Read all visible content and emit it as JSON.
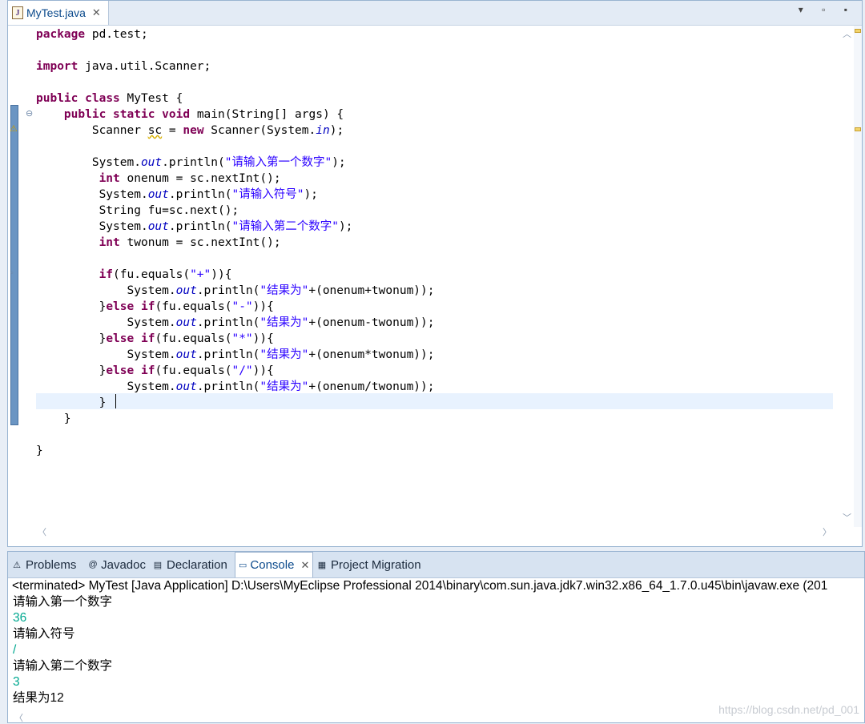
{
  "editor": {
    "tab_title": "MyTest.java",
    "tab_icon": "java-file-icon",
    "window_controls": "▾ ▫ ▪",
    "lines": [
      [
        {
          "t": "package",
          "c": "kw"
        },
        {
          "t": " pd.test;"
        }
      ],
      [],
      [
        {
          "t": "import",
          "c": "kw"
        },
        {
          "t": " java.util.Scanner;"
        }
      ],
      [],
      [
        {
          "t": "public",
          "c": "kw"
        },
        {
          "t": " "
        },
        {
          "t": "class",
          "c": "kw"
        },
        {
          "t": " MyTest {"
        }
      ],
      [
        {
          "t": "    "
        },
        {
          "t": "public",
          "c": "kw"
        },
        {
          "t": " "
        },
        {
          "t": "static",
          "c": "kw"
        },
        {
          "t": " "
        },
        {
          "t": "void",
          "c": "kw"
        },
        {
          "t": " main(String[] args) {"
        }
      ],
      [
        {
          "t": "        Scanner "
        },
        {
          "t": "sc",
          "c": "warn"
        },
        {
          "t": " = "
        },
        {
          "t": "new",
          "c": "kw"
        },
        {
          "t": " Scanner(System."
        },
        {
          "t": "in",
          "c": "fld"
        },
        {
          "t": ");"
        }
      ],
      [],
      [
        {
          "t": "        System."
        },
        {
          "t": "out",
          "c": "fld"
        },
        {
          "t": ".println("
        },
        {
          "t": "\"请输入第一个数字\"",
          "c": "str"
        },
        {
          "t": ");"
        }
      ],
      [
        {
          "t": "         "
        },
        {
          "t": "int",
          "c": "kw"
        },
        {
          "t": " onenum = sc.nextInt();"
        }
      ],
      [
        {
          "t": "         System."
        },
        {
          "t": "out",
          "c": "fld"
        },
        {
          "t": ".println("
        },
        {
          "t": "\"请输入符号\"",
          "c": "str"
        },
        {
          "t": ");"
        }
      ],
      [
        {
          "t": "         String fu=sc.next();"
        }
      ],
      [
        {
          "t": "         System."
        },
        {
          "t": "out",
          "c": "fld"
        },
        {
          "t": ".println("
        },
        {
          "t": "\"请输入第二个数字\"",
          "c": "str"
        },
        {
          "t": ");"
        }
      ],
      [
        {
          "t": "         "
        },
        {
          "t": "int",
          "c": "kw"
        },
        {
          "t": " twonum = sc.nextInt();"
        }
      ],
      [],
      [
        {
          "t": "         "
        },
        {
          "t": "if",
          "c": "kw"
        },
        {
          "t": "(fu.equals("
        },
        {
          "t": "\"+\"",
          "c": "str"
        },
        {
          "t": ")){"
        }
      ],
      [
        {
          "t": "             System."
        },
        {
          "t": "out",
          "c": "fld"
        },
        {
          "t": ".println("
        },
        {
          "t": "\"结果为\"",
          "c": "str"
        },
        {
          "t": "+(onenum+twonum));"
        }
      ],
      [
        {
          "t": "         }"
        },
        {
          "t": "else",
          "c": "kw"
        },
        {
          "t": " "
        },
        {
          "t": "if",
          "c": "kw"
        },
        {
          "t": "(fu.equals("
        },
        {
          "t": "\"-\"",
          "c": "str"
        },
        {
          "t": ")){"
        }
      ],
      [
        {
          "t": "             System."
        },
        {
          "t": "out",
          "c": "fld"
        },
        {
          "t": ".println("
        },
        {
          "t": "\"结果为\"",
          "c": "str"
        },
        {
          "t": "+(onenum-twonum));"
        }
      ],
      [
        {
          "t": "         }"
        },
        {
          "t": "else",
          "c": "kw"
        },
        {
          "t": " "
        },
        {
          "t": "if",
          "c": "kw"
        },
        {
          "t": "(fu.equals("
        },
        {
          "t": "\"*\"",
          "c": "str"
        },
        {
          "t": ")){"
        }
      ],
      [
        {
          "t": "             System."
        },
        {
          "t": "out",
          "c": "fld"
        },
        {
          "t": ".println("
        },
        {
          "t": "\"结果为\"",
          "c": "str"
        },
        {
          "t": "+(onenum*twonum));"
        }
      ],
      [
        {
          "t": "         }"
        },
        {
          "t": "else",
          "c": "kw"
        },
        {
          "t": " "
        },
        {
          "t": "if",
          "c": "kw"
        },
        {
          "t": "(fu.equals("
        },
        {
          "t": "\"/\"",
          "c": "str"
        },
        {
          "t": ")){"
        }
      ],
      [
        {
          "t": "             System."
        },
        {
          "t": "out",
          "c": "fld"
        },
        {
          "t": ".println("
        },
        {
          "t": "\"结果为\"",
          "c": "str"
        },
        {
          "t": "+(onenum/twonum));"
        }
      ],
      [
        {
          "t": "         }"
        }
      ],
      [
        {
          "t": "    }"
        }
      ],
      [],
      [
        {
          "t": "}"
        }
      ]
    ]
  },
  "console": {
    "tabs": [
      {
        "label": "Problems",
        "icon": "problems-icon",
        "glyph": "⚠",
        "active": false
      },
      {
        "label": "Javadoc",
        "icon": "javadoc-icon",
        "glyph": "@",
        "active": false
      },
      {
        "label": "Declaration",
        "icon": "declaration-icon",
        "glyph": "▤",
        "active": false
      },
      {
        "label": "Console",
        "icon": "console-icon",
        "glyph": "▭",
        "active": true
      },
      {
        "label": "Project Migration",
        "icon": "migration-icon",
        "glyph": "▦",
        "active": false
      }
    ],
    "close_glyph": "✕",
    "header": "<terminated> MyTest [Java Application] D:\\Users\\MyEclipse Professional 2014\\binary\\com.sun.java.jdk7.win32.x86_64_1.7.0.u45\\bin\\javaw.exe (201",
    "lines": [
      {
        "text": "请输入第一个数字",
        "kind": "out"
      },
      {
        "text": "36",
        "kind": "inp"
      },
      {
        "text": "请输入符号",
        "kind": "out"
      },
      {
        "text": "/",
        "kind": "inp"
      },
      {
        "text": "请输入第二个数字",
        "kind": "out"
      },
      {
        "text": "3",
        "kind": "inp"
      },
      {
        "text": "结果为12",
        "kind": "out"
      }
    ],
    "watermark": "https://blog.csdn.net/pd_001"
  }
}
